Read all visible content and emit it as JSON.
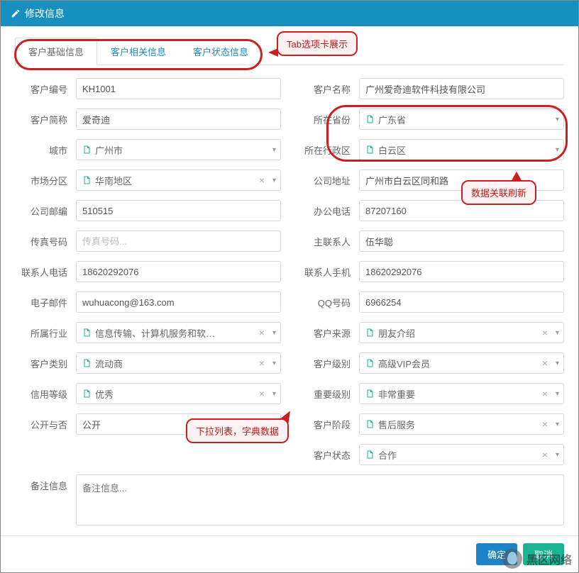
{
  "title": "修改信息",
  "tabs": [
    "客户基础信息",
    "客户相关信息",
    "客户状态信息"
  ],
  "labels": {
    "customerNo": "客户编号",
    "customerName": "客户名称",
    "shortName": "客户简称",
    "province": "所在省份",
    "city": "城市",
    "district": "所在行政区",
    "region": "市场分区",
    "address": "公司地址",
    "zip": "公司邮编",
    "tel": "办公电话",
    "fax": "传真号码",
    "contact": "主联系人",
    "contactTel": "联系人电话",
    "contactMobile": "联系人手机",
    "email": "电子邮件",
    "qq": "QQ号码",
    "industry": "所属行业",
    "source": "客户来源",
    "category": "客户类别",
    "level": "客户级别",
    "credit": "信用等级",
    "importance": "重要级别",
    "publicFlag": "公开与否",
    "stage": "客户阶段",
    "status": "客户状态",
    "remark": "备注信息"
  },
  "values": {
    "customerNo": "KH1001",
    "customerName": "广州爱奇迪软件科技有限公司",
    "shortName": "爱奇迪",
    "province": "广东省",
    "city": "广州市",
    "district": "白云区",
    "region": "华南地区",
    "address": "广州市白云区同和路",
    "zip": "510515",
    "tel": "87207160",
    "fax": "",
    "contact": "伍华聪",
    "contactTel": "18620292076",
    "contactMobile": "18620292076",
    "email": "wuhuacong@163.com",
    "qq": "6966254",
    "industry": "信息传输、计算机服务和软…",
    "source": "朋友介绍",
    "category": "流动商",
    "level": "高级VIP会员",
    "credit": "优秀",
    "importance": "非常重要",
    "publicFlag": "公开",
    "stage": "售后服务",
    "status": "合作",
    "remark": ""
  },
  "placeholders": {
    "fax": "传真号码...",
    "remark": "备注信息..."
  },
  "buttons": {
    "ok": "确定",
    "cancel": "取消"
  },
  "annotations": {
    "tabs": "Tab选项卡展示",
    "linked": "数据关联刷新",
    "dropdown": "下拉列表，字典数据"
  },
  "watermark": "黑区网络"
}
